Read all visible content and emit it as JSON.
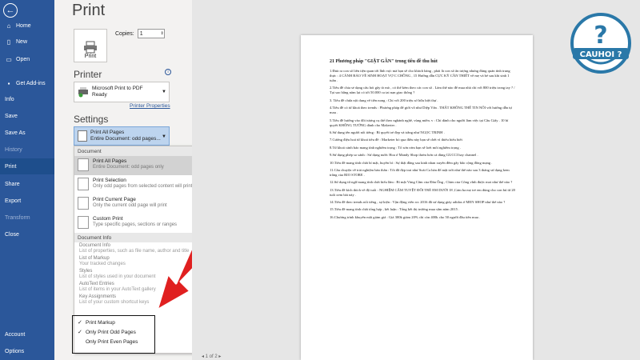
{
  "nav": {
    "items": [
      {
        "label": "Home",
        "icon": "home-icon"
      },
      {
        "label": "New",
        "icon": "new-document-icon"
      },
      {
        "label": "Open",
        "icon": "folder-icon"
      },
      {
        "label": "Get Add-ins",
        "icon": "store-icon"
      },
      {
        "label": "Info"
      },
      {
        "label": "Save"
      },
      {
        "label": "Save As"
      },
      {
        "label": "History"
      },
      {
        "label": "Print"
      },
      {
        "label": "Share"
      },
      {
        "label": "Export"
      },
      {
        "label": "Transform"
      },
      {
        "label": "Close"
      },
      {
        "label": "Account"
      },
      {
        "label": "Options"
      }
    ],
    "active": "Print",
    "accent_color": "#2b579a"
  },
  "print": {
    "title": "Print",
    "button_label": "Print",
    "copies_label": "Copies:",
    "copies_value": "1"
  },
  "printer": {
    "heading": "Printer",
    "name": "Microsoft Print to PDF",
    "status": "Ready",
    "properties_link": "Printer Properties"
  },
  "settings": {
    "heading": "Settings",
    "selected_title": "Print All Pages",
    "selected_sub": "Entire Document: odd pages..."
  },
  "menu": {
    "document_header": "Document",
    "items": [
      {
        "title": "Print All Pages",
        "sub": "Entire Document: odd pages only"
      },
      {
        "title": "Print Selection",
        "sub": "Only odd pages from selected content will print"
      },
      {
        "title": "Print Current Page",
        "sub": "Only the current odd page will print"
      },
      {
        "title": "Custom Print",
        "sub": "Type specific pages, sections or ranges"
      }
    ],
    "info_header": "Document Info",
    "info_items": [
      {
        "title": "Document Info",
        "sub": "List of properties, such as file name, author and title"
      },
      {
        "title": "List of Markup",
        "sub": "Your tracked changes"
      },
      {
        "title": "Styles",
        "sub": "List of styles used in your document"
      },
      {
        "title": "AutoText Entries",
        "sub": "List of items in your AutoText gallery"
      },
      {
        "title": "Key Assignments",
        "sub": "List of your custom shortcut keys"
      }
    ],
    "options": [
      {
        "label": "Print Markup",
        "checked": true
      },
      {
        "label": "Only Print Odd Pages",
        "checked": true
      },
      {
        "label": "Only Print Even Pages",
        "checked": false
      }
    ]
  },
  "document": {
    "heading": "21 Phương pháp \"GIẬT GÂN\" trong tiêu đề thu hút",
    "lines": [
      "1.Đưa ra con số liên tiện quan tới lĩnh vực mà bạn sẽ cho khách hàng , phải là con số ấn tượng nhưng đúng quản tính trung thực : 4 CÁNH BẢO VỀ SINH HOẠT VỢ C CHỒNG , 15 Hướng dẫn CỰC KỲ CẦN THIẾT về mẹ và bé sau khi sinh 1 tuần .",
      "2.Tiêu đề chia sẻ dạng câu hỏi gây tò mò , có thể kèm theo các con số . Làm thế nào để mua nhà chỉ với 800 triệu trong tay ? / Tại sao hằng năm lại có tới 50.000 ca tai nạn giao thông ?",
      "3. Tiêu đề chứa nội dung về tiền nong : Chỉ với 200 triệu sở hữu biệt thự .",
      "4.Tiêu đề có từ khoá theo trends : Phương pháp để giời võ như Diệp Vấn . THẤT KHÔNG THỂ TIN NỔI với hướng dẫn tự mau .",
      "5.Tiêu đề hướng vào đối tượng cụ thể theo nghành nghề, vùng miền. v : Chỉ dành cho người làm việc tại Cầu Giấy . 10 bí quyết KHÔNG TƯỞNG dành cho Makerter .",
      "6.Sử dụng tên người nổi tiếng : Bí quyết trẻ đẹp và trắng như NGỌC TRINH .",
      "7.Cường điệu hoá từ khoá tiêu đề : Marketer bỏ qua điều này bạn sẽ chết vì thiếu hiểu biết",
      "8.Từ khoá cảnh báo mang tính nghiêm trọng : Tổ sơn rơm bạn sẽ loét môi nghiêm trọng .",
      "9.Sử dụng phép so sánh : Sử dụng nước Hoa ở Mandy Shop thơm hơn cả dùng GUCCI hay channel .",
      "10.Tiêu đề mang tính chất bí mật, huyền bí : Sự thật đằng sau kinh nhan xuyên đêm gây bão cộng đồng mạng .",
      "11.Câu chuyện về trải nghiệm bản thân : Tôi đã đẹp trai như Soái Ca hàn để mặt trời như thế nào sau 3 tháng sử dụng kem trắng của RIO STORE .",
      "12.Sử dụng từ ngữ mang tính chất hiểu lầm : Bí mật Vàng Cầm của Đàn Ông , Chim của Công vĩnh được moi như thế nào ?",
      "13.Tiêu đề kích thích về độ tuổi : NGHIỆM CẮM TUYỆT ĐỐI TRẺ EM DƯỚI 18 ,Cảm ba mẹ trẻ em dùng cho con bú từ 20 tuổi xem bài này .",
      "14.Tiêu đề theo trends nổi tiếng , sự kiện : Vận động viên wc 2016 đã sử dụng giày adidas ở MEN SHOP như thế nào ?",
      "15.Tiêu đề mang tính chất tổng hợp , kết luận : Tổng kết thị trường mua sắm năm 2015 .",
      "16.Chương trình khuyến mãi giảm giá : Giá 300k giảm 20% chỉ còn 400k cho 50 người đầu tiên mua ."
    ]
  },
  "footer_text": "◂  1  of 2  ▸",
  "logo": {
    "text": "CAUHOI",
    "mark": "?",
    "color": "#2a78a8"
  }
}
